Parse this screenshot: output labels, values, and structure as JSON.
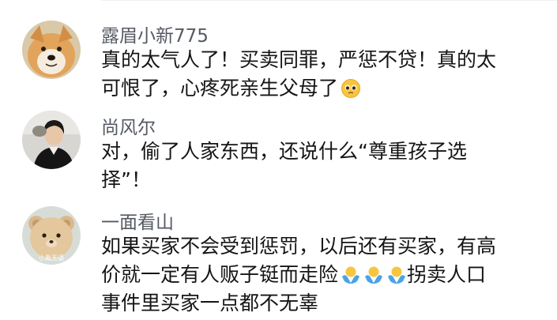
{
  "comments": [
    {
      "username": "露眉小新775",
      "lines": [
        "真的太气人了！买卖同罪，严惩不贷！真的太",
        "可恨了，心疼死亲生父母了"
      ],
      "trailing_emojis": [
        "pleading-face"
      ]
    },
    {
      "username": "尚风尔",
      "lines": [
        "对，偷了人家东西，还说什么“尊重孩子选",
        "择”！"
      ],
      "trailing_emojis": []
    },
    {
      "username": "一面看山",
      "avatar_watermark": "小胤无语",
      "lines": [
        "如果买家不会受到惩罚，以后还有买家，有高",
        "价就一定有人贩子铤而走险",
        "事件里买家一点都不无辜"
      ],
      "line2_emojis": [
        "shrug-person",
        "shrug-person",
        "shrug-person"
      ],
      "line2_suffix": "拐卖人口"
    }
  ],
  "colors": {
    "username": "#555a63",
    "text": "#151515",
    "background": "#ffffff"
  }
}
